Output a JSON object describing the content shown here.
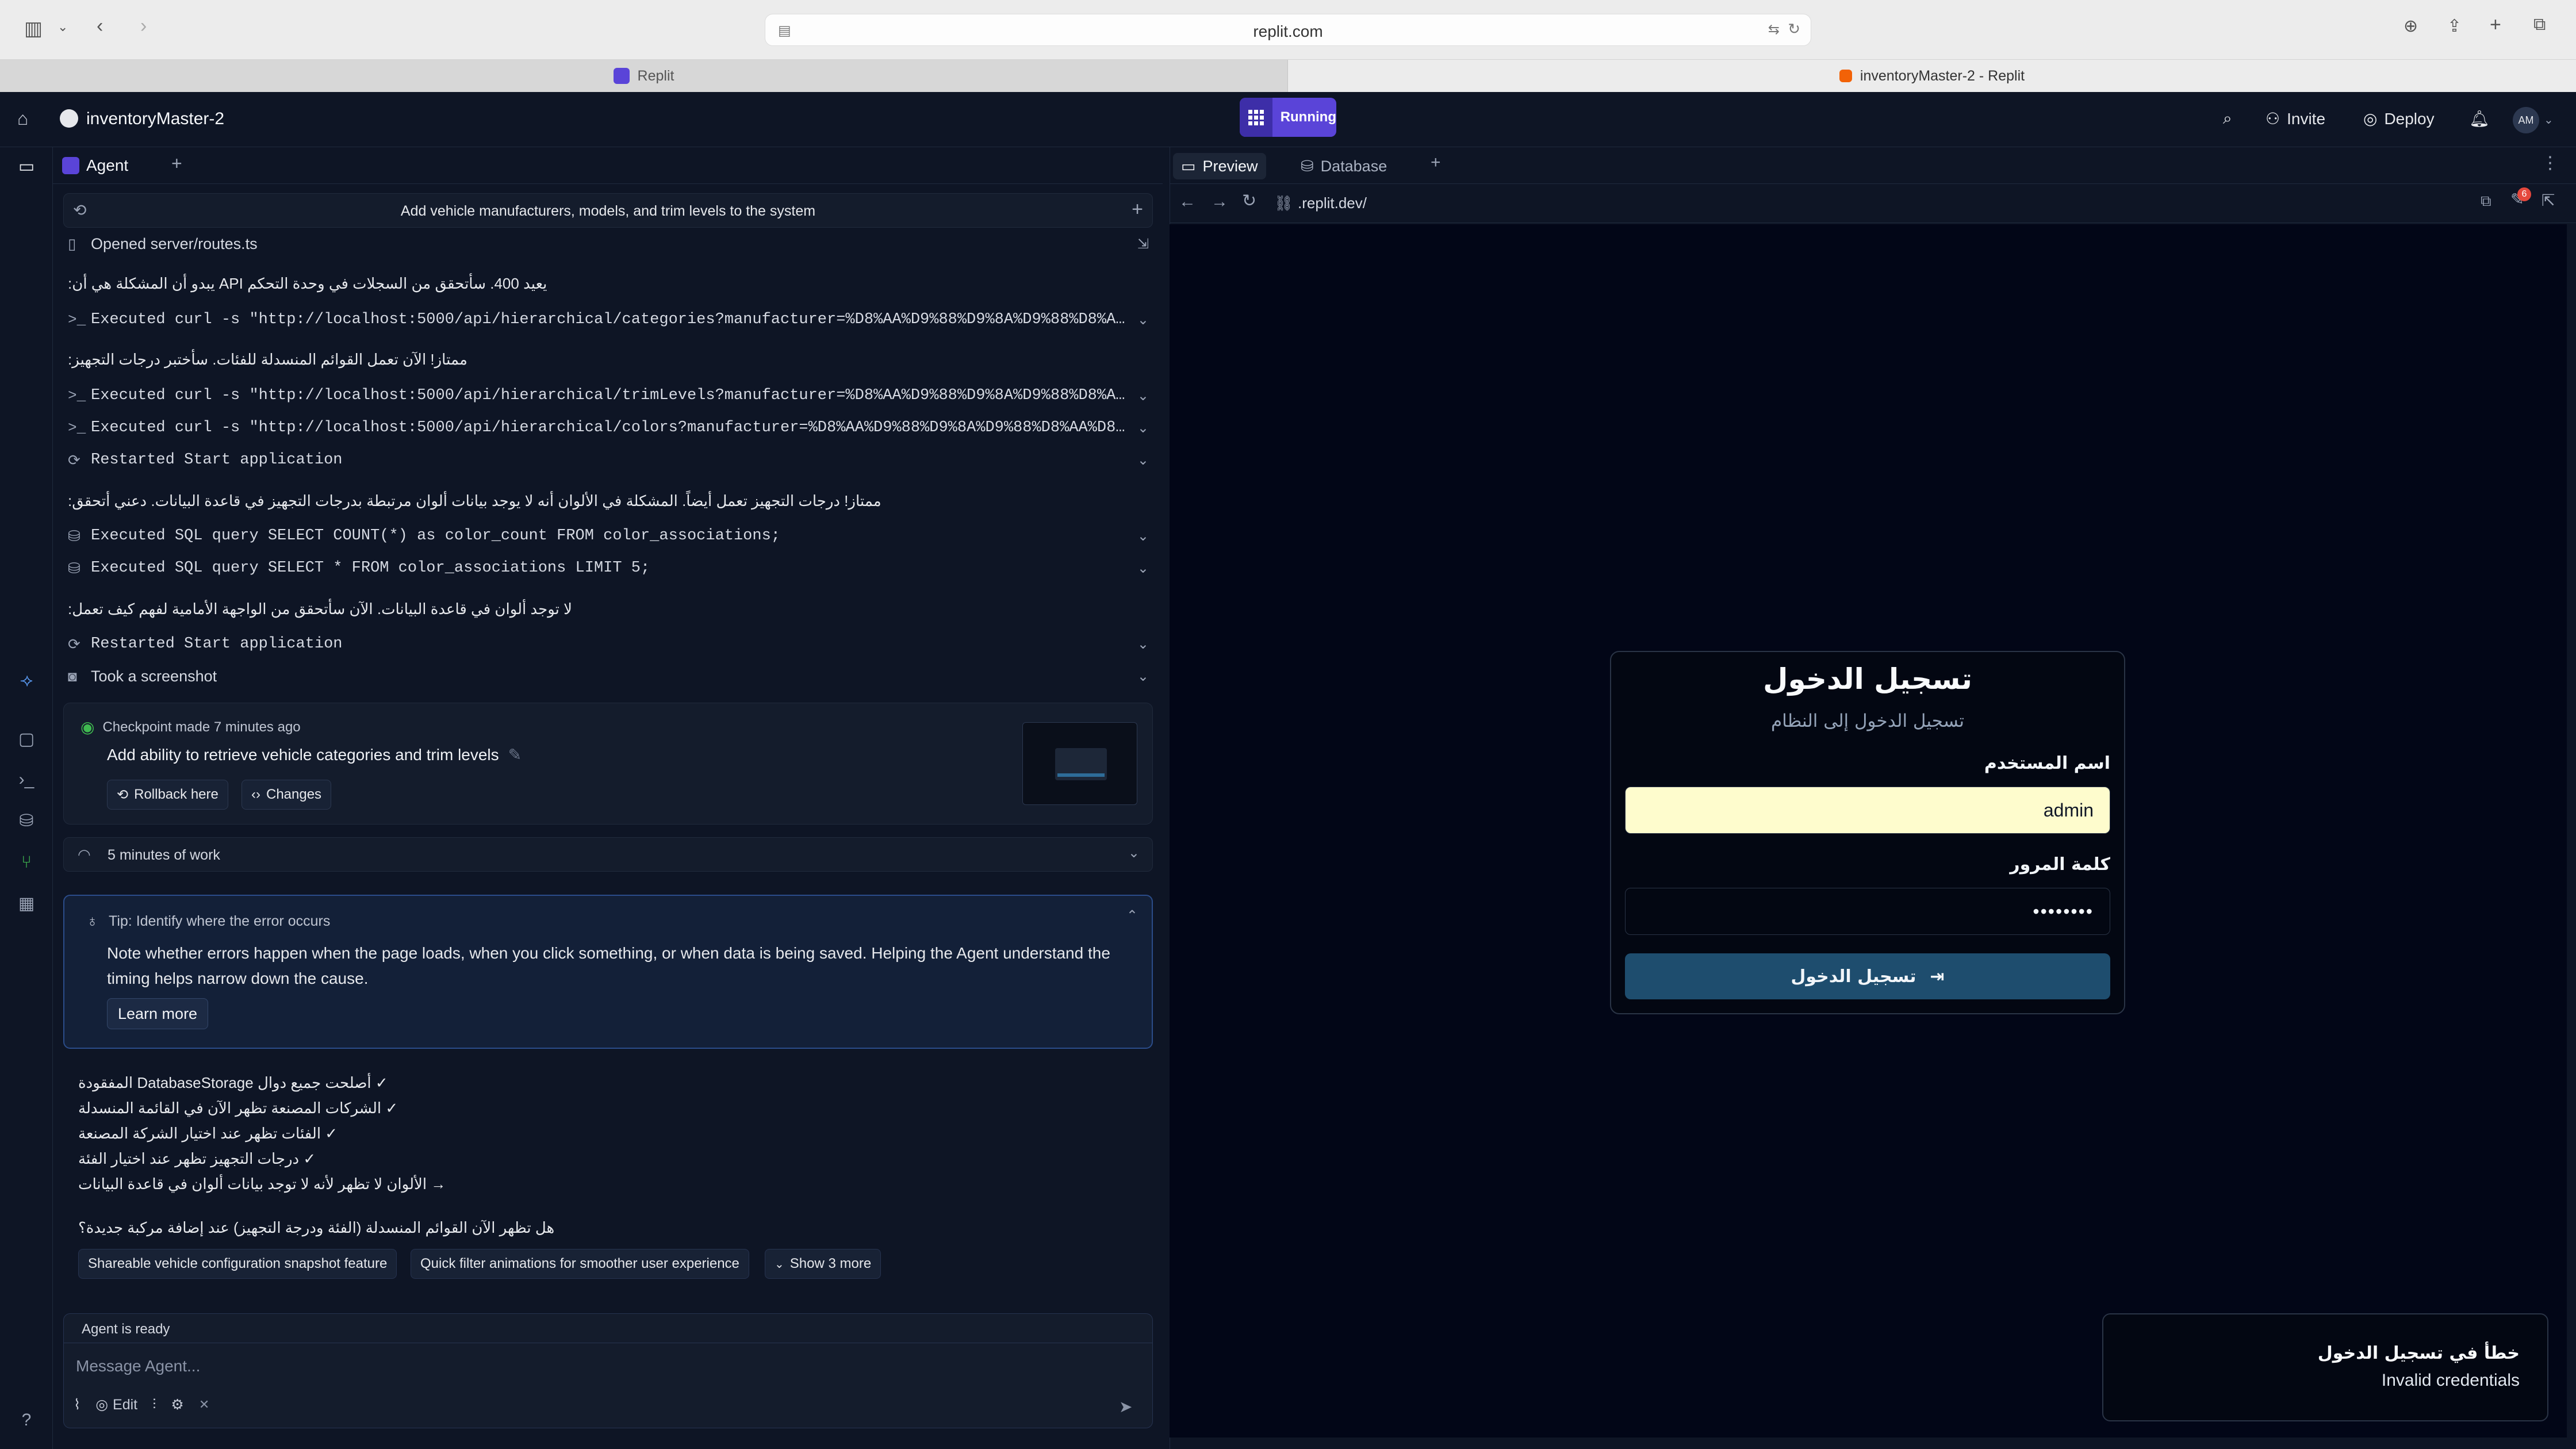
{
  "browser": {
    "url": "replit.com",
    "tabs": [
      {
        "label": "Replit"
      },
      {
        "label": "inventoryMaster-2 - Replit"
      }
    ]
  },
  "topbar": {
    "project_name": "inventoryMaster-2",
    "run_status": "Running",
    "invite_label": "Invite",
    "deploy_label": "Deploy",
    "avatar_initials": "AM"
  },
  "agent": {
    "tab_label": "Agent",
    "task_title": "Add vehicle manufacturers, models, and trim levels to the system",
    "log": [
      {
        "kind": "file",
        "text": "Opened server/routes.ts"
      },
      {
        "kind": "msg",
        "text": "يعيد 400. سأتحقق من السجلات في وحدة التحكم API يبدو أن المشكلة هي أن:"
      },
      {
        "kind": "shell",
        "text": "Executed curl -s \"http://localhost:5000/api/hierarchical/categories?manufacturer=%D8%AA%D9%88%D9%8A%D9%88%D8%AA%D..."
      },
      {
        "kind": "msg",
        "text": "ممتاز! الآن تعمل القوائم المنسدلة للفئات. سأختبر درجات التجهيز:"
      },
      {
        "kind": "shell",
        "text": "Executed curl -s \"http://localhost:5000/api/hierarchical/trimLevels?manufacturer=%D8%AA%D9%88%D9%8A%D9%88%D8%AA%D..."
      },
      {
        "kind": "shell",
        "text": "Executed curl -s \"http://localhost:5000/api/hierarchical/colors?manufacturer=%D8%AA%D9%88%D9%8A%D9%88%D8%AA%D8%A7..."
      },
      {
        "kind": "restart",
        "text": "Restarted Start application"
      },
      {
        "kind": "msg",
        "text": "ممتاز! درجات التجهيز تعمل أيضاً. المشكلة في الألوان أنه لا يوجد بيانات ألوان مرتبطة بدرجات التجهيز في قاعدة البيانات. دعني أتحقق:"
      },
      {
        "kind": "sql",
        "text": "Executed SQL query SELECT COUNT(*) as color_count FROM color_associations;"
      },
      {
        "kind": "sql",
        "text": "Executed SQL query SELECT * FROM color_associations LIMIT 5;"
      },
      {
        "kind": "msg",
        "text": "لا توجد ألوان في قاعدة البيانات. الآن سأتحقق من الواجهة الأمامية لفهم كيف تعمل:"
      },
      {
        "kind": "restart",
        "text": "Restarted Start application"
      },
      {
        "kind": "screenshot",
        "text": "Took a screenshot"
      }
    ],
    "checkpoint": {
      "meta": "Checkpoint made 7 minutes ago",
      "title": "Add ability to retrieve vehicle categories and trim levels",
      "rollback_label": "Rollback here",
      "changes_label": "Changes"
    },
    "work_label": "5 minutes of work",
    "tip": {
      "heading": "Tip: Identify where the error occurs",
      "body": "Note whether errors happen when the page loads, when you click something, or when data is being saved. Helping the Agent understand the timing helps narrow down the cause.",
      "learn_more": "Learn more"
    },
    "summary": [
      "✓ أصلحت جميع دوال DatabaseStorage المفقودة",
      "✓ الشركات المصنعة تظهر الآن في القائمة المنسدلة",
      "✓ الفئات تظهر عند اختيار الشركة المصنعة",
      "✓ درجات التجهيز تظهر عند اختيار الفئة",
      "→ الألوان لا تظهر لأنه لا توجد بيانات ألوان في قاعدة البيانات"
    ],
    "question": "هل تظهر الآن القوائم المنسدلة (الفئة ودرجة التجهيز) عند إضافة مركبة جديدة؟",
    "suggestions": [
      "Shareable vehicle configuration snapshot feature",
      "Quick filter animations for smoother user experience",
      "Show 3 more"
    ],
    "composer": {
      "status": "Agent is ready",
      "placeholder": "Message Agent...",
      "edit_label": "Edit"
    }
  },
  "preview": {
    "tabs": [
      "Preview",
      "Database"
    ],
    "address": ".replit.dev/",
    "badge_count": "6",
    "login": {
      "title": "تسجيل الدخول",
      "subtitle": "تسجيل الدخول إلى النظام",
      "username_label": "اسم المستخدم",
      "username_value": "admin",
      "password_label": "كلمة المرور",
      "password_value": "••••••••",
      "submit_label": "تسجيل الدخول"
    },
    "toast": {
      "title": "خطأ في تسجيل الدخول",
      "message": "Invalid credentials"
    }
  },
  "colors": {
    "accent": "#5a44d8",
    "login_button": "#1e4d6e",
    "tip_border": "#2b4c8a"
  }
}
